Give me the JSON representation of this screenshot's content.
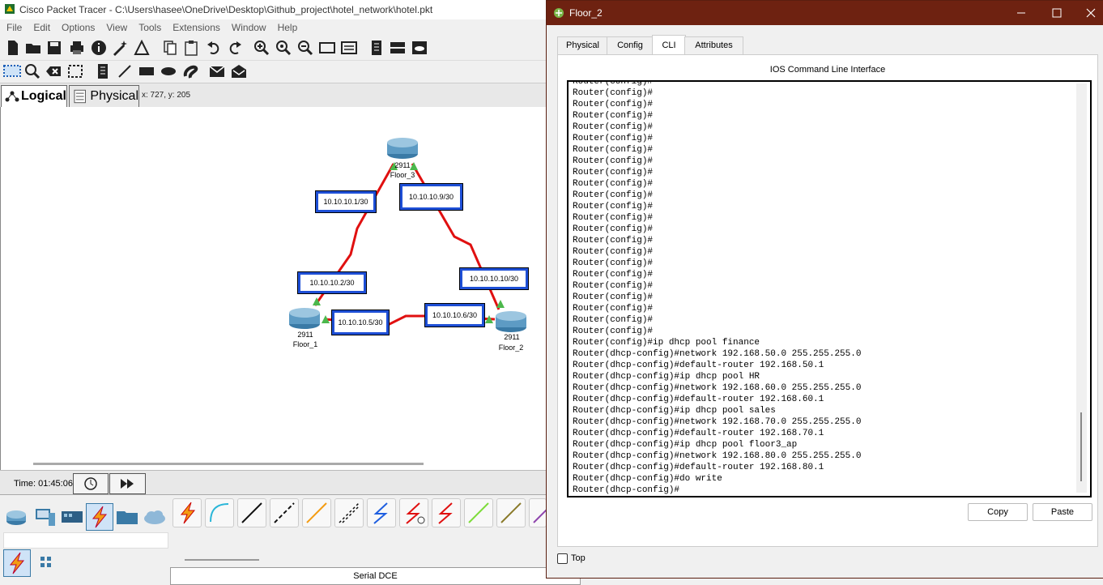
{
  "main_window": {
    "title": "Cisco Packet Tracer - C:\\Users\\hasee\\OneDrive\\Desktop\\Github_project\\hotel_network\\hotel.pkt",
    "menu": [
      "File",
      "Edit",
      "Options",
      "View",
      "Tools",
      "Extensions",
      "Window",
      "Help"
    ],
    "view_tabs": {
      "logical": "Logical",
      "physical": "Physical"
    },
    "coords": "x: 727, y: 205",
    "time": "Time: 01:45:06",
    "cable_label": "Serial DCE"
  },
  "topology": {
    "routers": [
      {
        "model": "2911",
        "name": "Floor_3"
      },
      {
        "model": "2911",
        "name": "Floor_1"
      },
      {
        "model": "2911",
        "name": "Floor_2"
      }
    ],
    "ip_labels": [
      "10.10.10.1/30",
      "10.10.10.9/30",
      "10.10.10.2/30",
      "10.10.10.10/30",
      "10.10.10.5/30",
      "10.10.10.6/30"
    ],
    "link_color": "#e01010",
    "label_border_color": "#1e4fd6"
  },
  "dialog": {
    "title": "Floor_2",
    "tabs": [
      "Physical",
      "Config",
      "CLI",
      "Attributes"
    ],
    "active_tab": "CLI",
    "cli_title": "IOS Command Line Interface",
    "cli_lines": [
      "Router(config)#",
      "Router(config)#",
      "Router(config)#",
      "Router(config)#",
      "Router(config)#",
      "Router(config)#",
      "Router(config)#",
      "Router(config)#",
      "Router(config)#",
      "Router(config)#",
      "Router(config)#",
      "Router(config)#",
      "Router(config)#",
      "Router(config)#",
      "Router(config)#",
      "Router(config)#",
      "Router(config)#",
      "Router(config)#",
      "Router(config)#",
      "Router(config)#",
      "Router(config)#",
      "Router(config)#",
      "Router(config)#",
      "Router(config)#ip dhcp pool finance",
      "Router(dhcp-config)#network 192.168.50.0 255.255.255.0",
      "Router(dhcp-config)#default-router 192.168.50.1",
      "Router(dhcp-config)#ip dhcp pool HR",
      "Router(dhcp-config)#network 192.168.60.0 255.255.255.0",
      "Router(dhcp-config)#default-router 192.168.60.1",
      "Router(dhcp-config)#ip dhcp pool sales",
      "Router(dhcp-config)#network 192.168.70.0 255.255.255.0",
      "Router(dhcp-config)#default-router 192.168.70.1",
      "Router(dhcp-config)#ip dhcp pool floor3_ap",
      "Router(dhcp-config)#network 192.168.80.0 255.255.255.0",
      "Router(dhcp-config)#default-router 192.168.80.1",
      "Router(dhcp-config)#do write",
      "Router(dhcp-config)#"
    ],
    "copy_label": "Copy",
    "paste_label": "Paste",
    "top_label": "Top",
    "title_bar_color": "#6e2211"
  }
}
